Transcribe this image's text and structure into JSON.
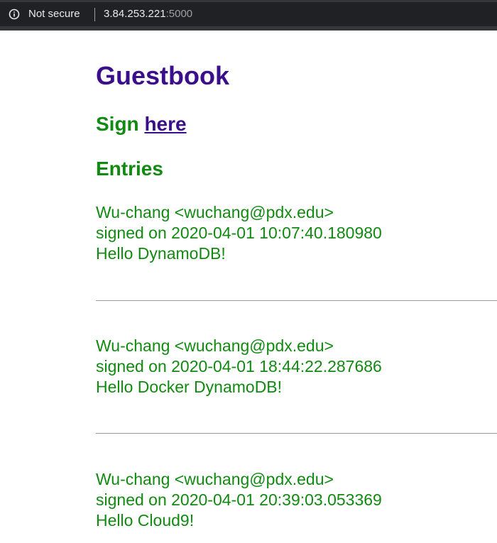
{
  "browser": {
    "security_label": "Not secure",
    "url_host": "3.84.253.221",
    "url_port": ":5000"
  },
  "page": {
    "title": "Guestbook",
    "sign_prefix": "Sign",
    "sign_link": "here",
    "entries_heading": "Entries"
  },
  "entries": [
    {
      "author": "Wu-chang <wuchang@pdx.edu>",
      "signed": "signed on 2020-04-01 10:07:40.180980",
      "message": "Hello DynamoDB!"
    },
    {
      "author": "Wu-chang <wuchang@pdx.edu>",
      "signed": "signed on 2020-04-01 18:44:22.287686",
      "message": "Hello Docker DynamoDB!"
    },
    {
      "author": "Wu-chang <wuchang@pdx.edu>",
      "signed": "signed on 2020-04-01 20:39:03.053369",
      "message": "Hello Cloud9!"
    }
  ]
}
